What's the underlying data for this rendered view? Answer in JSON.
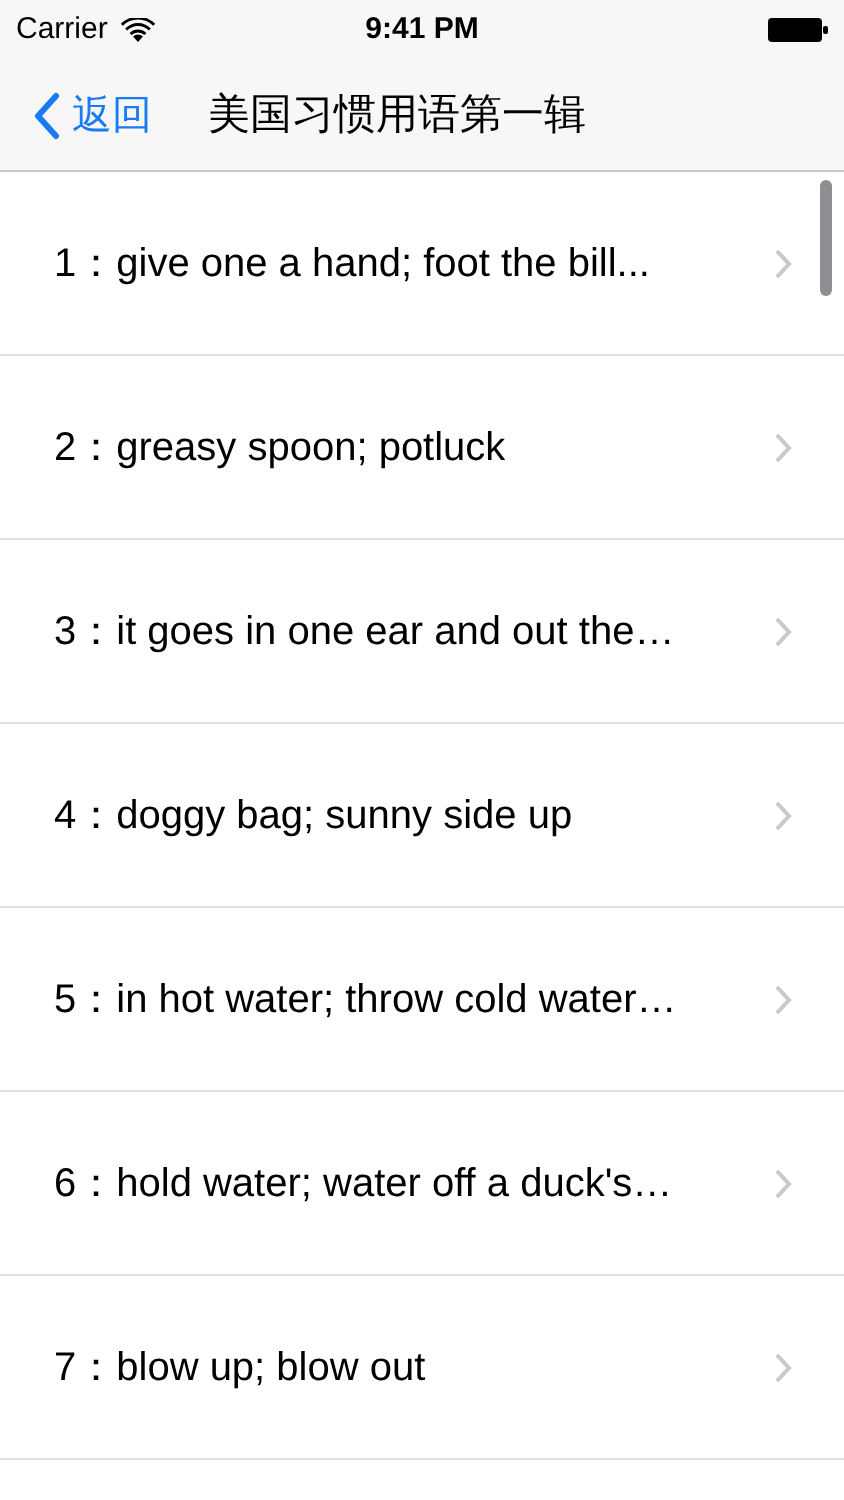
{
  "status_bar": {
    "carrier": "Carrier",
    "time": "9:41 PM"
  },
  "nav_bar": {
    "back": "返回",
    "title": "美国习惯用语第一辑"
  },
  "rows": [
    {
      "label": "1：give one a hand; foot the bill..."
    },
    {
      "label": "2：greasy spoon; potluck"
    },
    {
      "label": "3：it goes in one ear and out the…"
    },
    {
      "label": "4：doggy bag; sunny side up"
    },
    {
      "label": "5：in hot water; throw cold water…"
    },
    {
      "label": "6：hold water; water off a duck's…"
    },
    {
      "label": "7：blow up; blow out"
    }
  ]
}
